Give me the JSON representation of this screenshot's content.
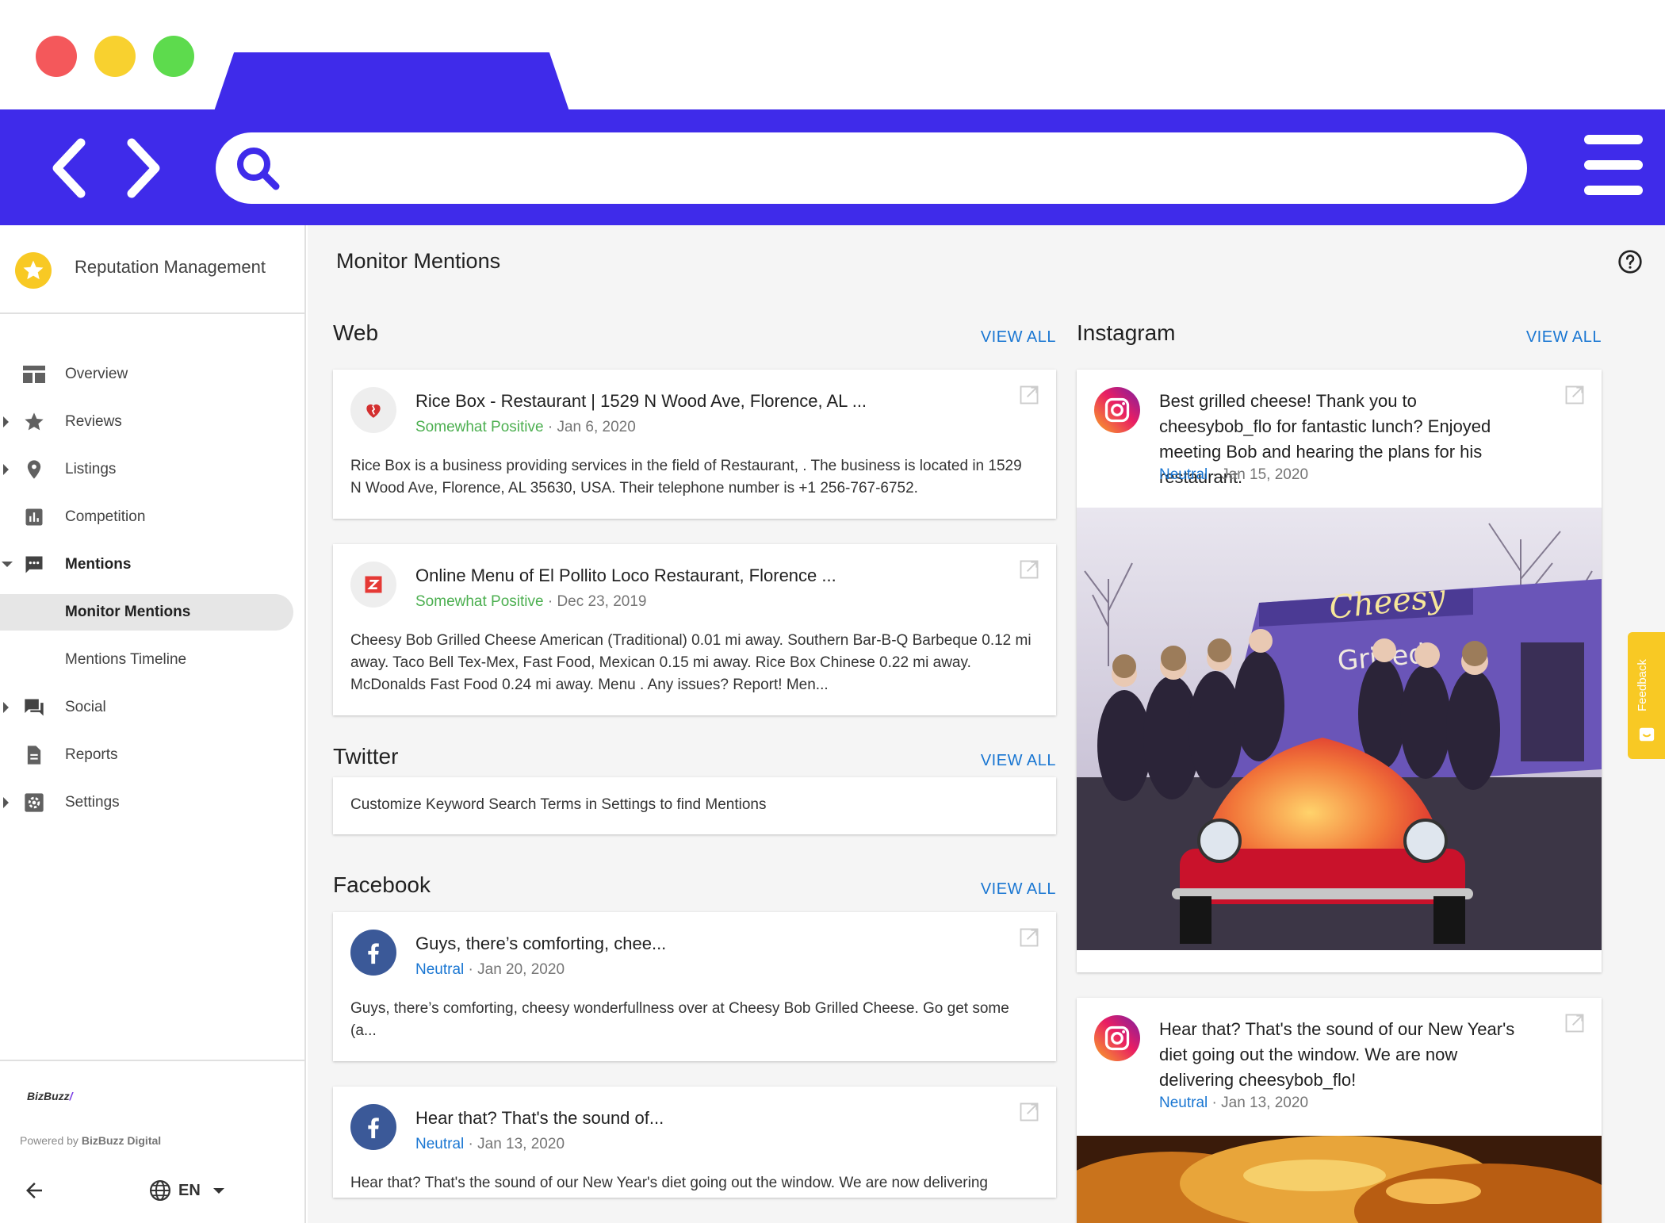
{
  "colors": {
    "chrome": "#3f2bea",
    "link": "#1976d2",
    "positive": "#4caf50",
    "star": "#f8c924"
  },
  "sidebar": {
    "title": "Reputation Management",
    "items": [
      {
        "label": "Overview",
        "icon": "overview-icon"
      },
      {
        "label": "Reviews",
        "icon": "star-icon"
      },
      {
        "label": "Listings",
        "icon": "location-pin-icon"
      },
      {
        "label": "Competition",
        "icon": "bar-chart-icon"
      },
      {
        "label": "Mentions",
        "icon": "comment-icon"
      },
      {
        "label": "Monitor Mentions"
      },
      {
        "label": "Mentions Timeline"
      },
      {
        "label": "Social",
        "icon": "forum-icon"
      },
      {
        "label": "Reports",
        "icon": "document-icon"
      },
      {
        "label": "Settings",
        "icon": "gear-icon"
      }
    ],
    "footer": {
      "logo_text": "BizBuzz",
      "powered_prefix": "Powered by ",
      "powered_name": "BizBuzz Digital",
      "language": "EN"
    }
  },
  "main": {
    "title": "Monitor Mentions",
    "view_all": "VIEW ALL",
    "web": {
      "title": "Web",
      "cards": [
        {
          "title": "Rice Box - Restaurant | 1529 N Wood Ave, Florence, AL ...",
          "sentiment": "Somewhat Positive",
          "date": " · Jan 6, 2020",
          "body": "Rice Box is a business providing services in the field of Restaurant, . The business is located in 1529 N Wood Ave, Florence, AL 35630, USA. Their telephone number is +1 256-767-6752."
        },
        {
          "title": "Online Menu of El Pollito Loco Restaurant, Florence ...",
          "sentiment": "Somewhat Positive",
          "date": " · Dec 23, 2019",
          "body": "Cheesy Bob Grilled Cheese American (Traditional) 0.01 mi away. Southern Bar-B-Q Barbeque 0.12 mi away. Taco Bell Tex-Mex, Fast Food, Mexican 0.15 mi away. Rice Box Chinese 0.22 mi away. McDonalds Fast Food 0.24 mi away. Menu . Any issues? Report! Men..."
        }
      ]
    },
    "twitter": {
      "title": "Twitter",
      "message": "Customize Keyword Search Terms in Settings to find Mentions"
    },
    "facebook": {
      "title": "Facebook",
      "cards": [
        {
          "title": "Guys, there’s comforting, chee...",
          "sentiment": "Neutral",
          "date": " · Jan 20, 2020",
          "body": "Guys, there’s comforting, cheesy wonderfullness over at Cheesy Bob Grilled Cheese. Go get some (a..."
        },
        {
          "title": "Hear that? That's the sound of...",
          "sentiment": "Neutral",
          "date": " · Jan 13, 2020",
          "body": "Hear that? That's the sound of our New Year's diet going out the window. We are now delivering"
        }
      ]
    },
    "instagram": {
      "title": "Instagram",
      "cards": [
        {
          "title": "Best grilled cheese! Thank you to cheesybob_flo for fantastic lunch? Enjoyed meeting Bob and hearing the plans for his restaurant.",
          "sentiment": "Neutral",
          "date": " · Jan 15, 2020"
        },
        {
          "title": "Hear that? That's the sound of our New Year's diet going out the window. We are now delivering cheesybob_flo!",
          "sentiment": "Neutral",
          "date": " · Jan 13, 2020"
        }
      ]
    },
    "feedback_label": "Feedback"
  }
}
